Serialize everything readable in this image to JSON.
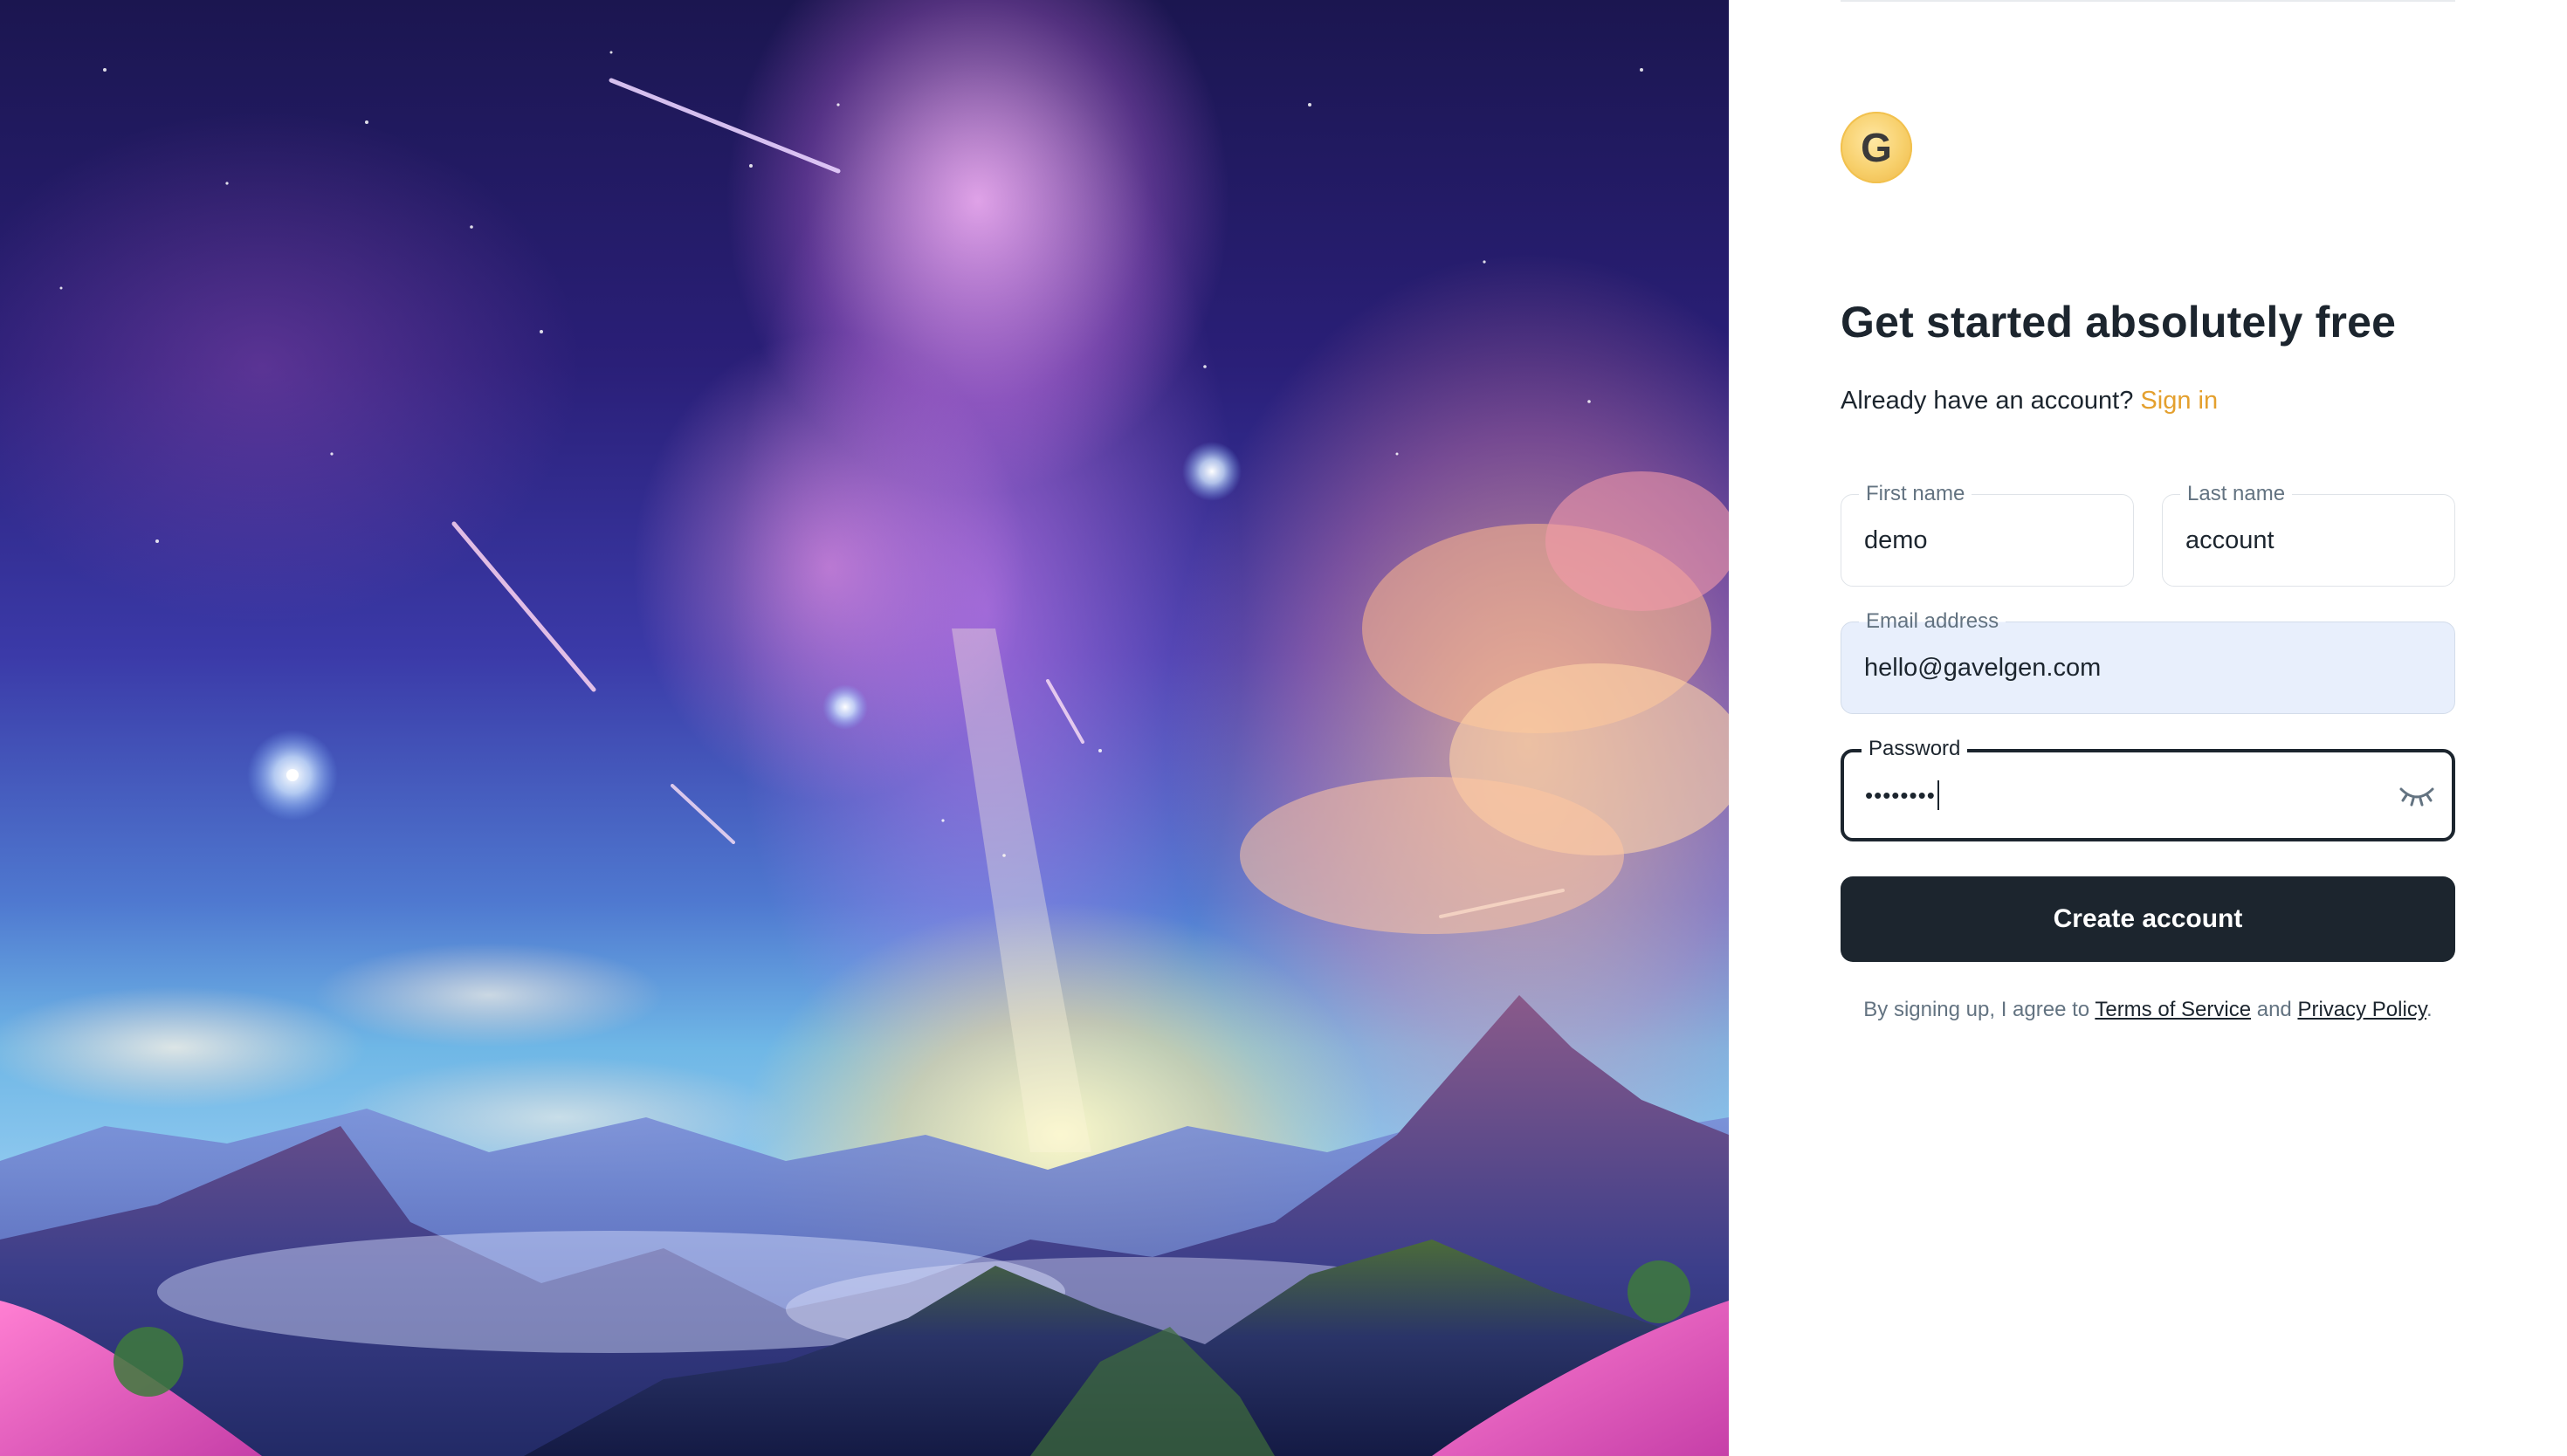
{
  "brand": {
    "logo_letter": "G"
  },
  "form": {
    "title": "Get started absolutely free",
    "signin_prompt": "Already have an account?",
    "signin_link": "Sign in",
    "first_name": {
      "label": "First name",
      "value": "demo"
    },
    "last_name": {
      "label": "Last name",
      "value": "account"
    },
    "email": {
      "label": "Email address",
      "value": "hello@gavelgen.com"
    },
    "password": {
      "label": "Password",
      "value": "••••••••",
      "toggle_icon": "eye-closed-icon"
    },
    "submit_label": "Create account",
    "terms_prefix": "By signing up, I agree to",
    "terms_link": "Terms of Service",
    "terms_and": "and",
    "privacy_link": "Privacy Policy",
    "terms_suffix": "."
  },
  "colors": {
    "primary_dark": "#1c252e",
    "accent_link": "#e4a02e",
    "autofill_bg": "#e8effc",
    "muted_text": "#637381"
  }
}
